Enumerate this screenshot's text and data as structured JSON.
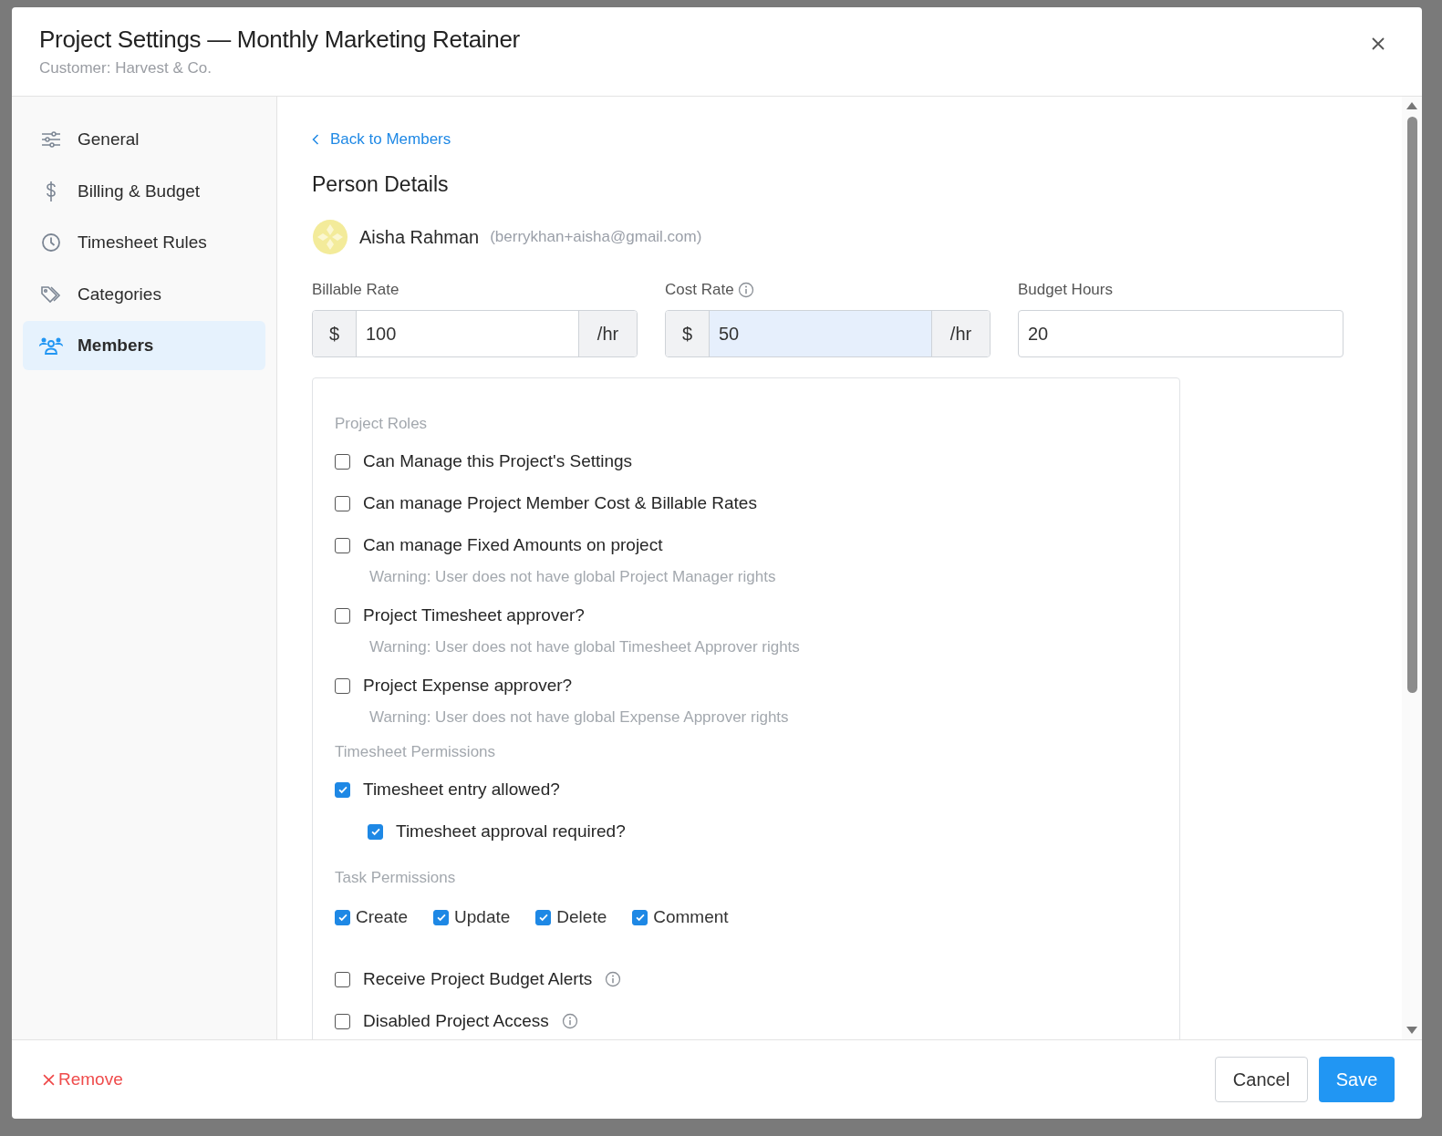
{
  "header": {
    "title": "Project Settings — Monthly Marketing Retainer",
    "subtitle": "Customer: Harvest & Co."
  },
  "sidebar": {
    "items": [
      {
        "label": "General",
        "selected": false
      },
      {
        "label": "Billing & Budget",
        "selected": false
      },
      {
        "label": "Timesheet Rules",
        "selected": false
      },
      {
        "label": "Categories",
        "selected": false
      },
      {
        "label": "Members",
        "selected": true
      }
    ]
  },
  "back_link": "Back to Members",
  "section_title": "Person Details",
  "person": {
    "name": "Aisha Rahman",
    "email": "(berrykhan+aisha@gmail.com)"
  },
  "rate_fields": [
    {
      "label": "Billable Rate",
      "info": false,
      "prefix": "$",
      "value": "100",
      "suffix": "/hr",
      "focused": false
    },
    {
      "label": "Cost Rate",
      "info": true,
      "prefix": "$",
      "value": "50",
      "suffix": "/hr",
      "focused": true
    },
    {
      "label": "Budget Hours",
      "info": false,
      "value": "20",
      "focused": false
    }
  ],
  "permission_groups": [
    {
      "heading": "Project Roles",
      "kind": "list",
      "items": [
        {
          "label": "Can Manage this Project's Settings",
          "checked": false
        },
        {
          "label": "Can manage Project Member Cost & Billable Rates",
          "checked": false
        },
        {
          "label": "Can manage Fixed Amounts on project",
          "checked": false,
          "warning": "Warning: User does not have global Project Manager rights"
        },
        {
          "label": "Project Timesheet approver?",
          "checked": false,
          "warning": "Warning: User does not have global Timesheet Approver rights"
        },
        {
          "label": "Project Expense approver?",
          "checked": false,
          "warning": "Warning: User does not have global Expense Approver rights"
        }
      ]
    },
    {
      "heading": "Timesheet Permissions",
      "kind": "list",
      "items": [
        {
          "label": "Timesheet entry allowed?",
          "checked": true,
          "children": [
            {
              "label": "Timesheet approval required?",
              "checked": true
            }
          ]
        }
      ]
    },
    {
      "heading": "Task Permissions",
      "kind": "inline",
      "items": [
        {
          "label": "Create",
          "checked": true
        },
        {
          "label": "Update",
          "checked": true
        },
        {
          "label": "Delete",
          "checked": true
        },
        {
          "label": "Comment",
          "checked": true
        }
      ]
    },
    {
      "kind": "list",
      "items": [
        {
          "label": "Receive Project Budget Alerts",
          "checked": false,
          "info": true
        },
        {
          "label": "Disabled Project Access",
          "checked": false,
          "info": true
        }
      ]
    }
  ],
  "footer": {
    "remove": "Remove",
    "cancel": "Cancel",
    "save": "Save"
  }
}
